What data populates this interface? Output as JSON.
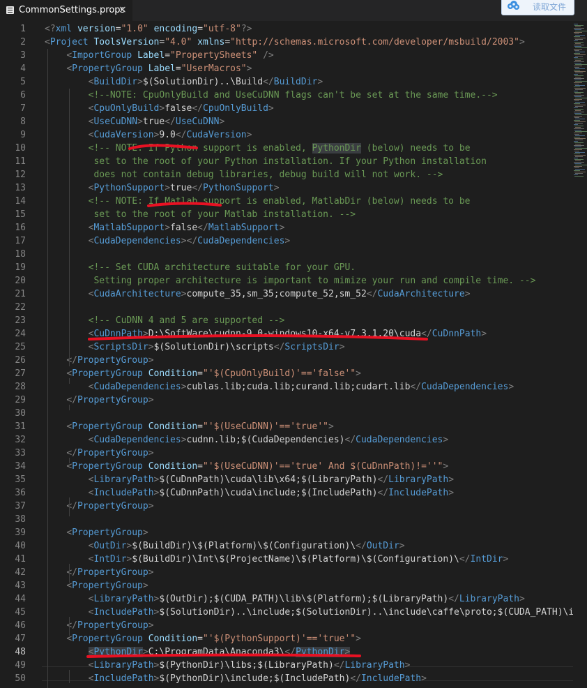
{
  "tab": {
    "title": "CommonSettings.props",
    "close": "×"
  },
  "overlay_button": {
    "label": "读取文件",
    "icon": "cloud-icon"
  },
  "colors": {
    "tag": "#569cd6",
    "bracket": "#808080",
    "attr": "#9cdcfe",
    "string": "#ce9178",
    "comment": "#6a9955",
    "text": "#d4d4d4",
    "annotation": "#e81123"
  },
  "current_line": 48,
  "lines": [
    {
      "n": "1",
      "tokens": [
        [
          "b",
          "<?"
        ],
        [
          "t",
          "xml "
        ],
        [
          "a",
          "version"
        ],
        [
          "x",
          "="
        ],
        [
          "s",
          "\"1.0\" "
        ],
        [
          "a",
          "encoding"
        ],
        [
          "x",
          "="
        ],
        [
          "s",
          "\"utf-8\""
        ],
        [
          "b",
          "?>"
        ]
      ]
    },
    {
      "n": "2",
      "tokens": [
        [
          "b",
          "<"
        ],
        [
          "t",
          "Project "
        ],
        [
          "a",
          "ToolsVersion"
        ],
        [
          "x",
          "="
        ],
        [
          "s",
          "\"4.0\" "
        ],
        [
          "a",
          "xmlns"
        ],
        [
          "x",
          "="
        ],
        [
          "s",
          "\"http://schemas.microsoft.com/developer/msbuild/2003\""
        ],
        [
          "b",
          ">"
        ]
      ]
    },
    {
      "n": "3",
      "tokens": [
        [
          "x",
          "    "
        ],
        [
          "b",
          "<"
        ],
        [
          "t",
          "ImportGroup "
        ],
        [
          "a",
          "Label"
        ],
        [
          "x",
          "="
        ],
        [
          "s",
          "\"PropertySheets\" "
        ],
        [
          "b",
          "/>"
        ]
      ]
    },
    {
      "n": "4",
      "tokens": [
        [
          "x",
          "    "
        ],
        [
          "b",
          "<"
        ],
        [
          "t",
          "PropertyGroup "
        ],
        [
          "a",
          "Label"
        ],
        [
          "x",
          "="
        ],
        [
          "s",
          "\"UserMacros\""
        ],
        [
          "b",
          ">"
        ]
      ]
    },
    {
      "n": "5",
      "tokens": [
        [
          "x",
          "        "
        ],
        [
          "b",
          "<"
        ],
        [
          "t",
          "BuildDir"
        ],
        [
          "b",
          ">"
        ],
        [
          "x",
          "$(SolutionDir)..\\Build"
        ],
        [
          "b",
          "</"
        ],
        [
          "t",
          "BuildDir"
        ],
        [
          "b",
          ">"
        ]
      ]
    },
    {
      "n": "6",
      "tokens": [
        [
          "x",
          "        "
        ],
        [
          "c",
          "<!--NOTE: CpuOnlyBuild and UseCuDNN flags can't be set at the same time.-->"
        ]
      ]
    },
    {
      "n": "7",
      "tokens": [
        [
          "x",
          "        "
        ],
        [
          "b",
          "<"
        ],
        [
          "t",
          "CpuOnlyBuild"
        ],
        [
          "b",
          ">"
        ],
        [
          "x",
          "false"
        ],
        [
          "b",
          "</"
        ],
        [
          "t",
          "CpuOnlyBuild"
        ],
        [
          "b",
          ">"
        ]
      ]
    },
    {
      "n": "8",
      "tokens": [
        [
          "x",
          "        "
        ],
        [
          "b",
          "<"
        ],
        [
          "t",
          "UseCuDNN"
        ],
        [
          "b",
          ">"
        ],
        [
          "x",
          "true"
        ],
        [
          "b",
          "</"
        ],
        [
          "t",
          "UseCuDNN"
        ],
        [
          "b",
          ">"
        ]
      ]
    },
    {
      "n": "9",
      "tokens": [
        [
          "x",
          "        "
        ],
        [
          "b",
          "<"
        ],
        [
          "t",
          "CudaVersion"
        ],
        [
          "b",
          ">"
        ],
        [
          "x",
          "9.0"
        ],
        [
          "b",
          "</"
        ],
        [
          "t",
          "CudaVersion"
        ],
        [
          "b",
          ">"
        ]
      ]
    },
    {
      "n": "10",
      "tokens": [
        [
          "x",
          "        "
        ],
        [
          "c",
          "<!-- NOTE: If Python support is enabled, "
        ],
        [
          "ch",
          "PythonDir"
        ],
        [
          "c",
          " (below) needs to be"
        ]
      ]
    },
    {
      "n": "11",
      "tokens": [
        [
          "c",
          "         set to the root of your Python installation. If your Python installation"
        ]
      ]
    },
    {
      "n": "12",
      "tokens": [
        [
          "c",
          "         does not contain debug libraries, debug build will not work. -->"
        ]
      ]
    },
    {
      "n": "13",
      "tokens": [
        [
          "x",
          "        "
        ],
        [
          "b",
          "<"
        ],
        [
          "t",
          "PythonSupport"
        ],
        [
          "b",
          ">"
        ],
        [
          "x",
          "true"
        ],
        [
          "b",
          "</"
        ],
        [
          "t",
          "PythonSupport"
        ],
        [
          "b",
          ">"
        ]
      ]
    },
    {
      "n": "14",
      "tokens": [
        [
          "x",
          "        "
        ],
        [
          "c",
          "<!-- NOTE: If Matlab support is enabled, MatlabDir (below) needs to be"
        ]
      ]
    },
    {
      "n": "15",
      "tokens": [
        [
          "c",
          "         set to the root of your Matlab installation. -->"
        ]
      ]
    },
    {
      "n": "16",
      "tokens": [
        [
          "x",
          "        "
        ],
        [
          "b",
          "<"
        ],
        [
          "t",
          "MatlabSupport"
        ],
        [
          "b",
          ">"
        ],
        [
          "x",
          "false"
        ],
        [
          "b",
          "</"
        ],
        [
          "t",
          "MatlabSupport"
        ],
        [
          "b",
          ">"
        ]
      ]
    },
    {
      "n": "17",
      "tokens": [
        [
          "x",
          "        "
        ],
        [
          "b",
          "<"
        ],
        [
          "t",
          "CudaDependencies"
        ],
        [
          "b",
          "></"
        ],
        [
          "t",
          "CudaDependencies"
        ],
        [
          "b",
          ">"
        ]
      ]
    },
    {
      "n": "18",
      "tokens": []
    },
    {
      "n": "19",
      "tokens": [
        [
          "x",
          "        "
        ],
        [
          "c",
          "<!-- Set CUDA architecture suitable for your GPU."
        ]
      ]
    },
    {
      "n": "20",
      "tokens": [
        [
          "c",
          "         Setting proper architecture is important to mimize your run and compile time. -->"
        ]
      ]
    },
    {
      "n": "21",
      "tokens": [
        [
          "x",
          "        "
        ],
        [
          "b",
          "<"
        ],
        [
          "t",
          "CudaArchitecture"
        ],
        [
          "b",
          ">"
        ],
        [
          "x",
          "compute_35,sm_35;compute_52,sm_52"
        ],
        [
          "b",
          "</"
        ],
        [
          "t",
          "CudaArchitecture"
        ],
        [
          "b",
          ">"
        ]
      ]
    },
    {
      "n": "22",
      "tokens": []
    },
    {
      "n": "23",
      "tokens": [
        [
          "x",
          "        "
        ],
        [
          "c",
          "<!-- CuDNN 4 and 5 are supported -->"
        ]
      ]
    },
    {
      "n": "24",
      "tokens": [
        [
          "x",
          "        "
        ],
        [
          "b",
          "<"
        ],
        [
          "t",
          "CuDnnPath"
        ],
        [
          "b",
          ">"
        ],
        [
          "x",
          "D:\\SoftWare\\cudnn-9.0-windows10-x64-v7.3.1.20\\cuda"
        ],
        [
          "b",
          "</"
        ],
        [
          "t",
          "CuDnnPath"
        ],
        [
          "b",
          ">"
        ]
      ]
    },
    {
      "n": "25",
      "tokens": [
        [
          "x",
          "        "
        ],
        [
          "b",
          "<"
        ],
        [
          "t",
          "ScriptsDir"
        ],
        [
          "b",
          ">"
        ],
        [
          "x",
          "$(SolutionDir)\\scripts"
        ],
        [
          "b",
          "</"
        ],
        [
          "t",
          "ScriptsDir"
        ],
        [
          "b",
          ">"
        ]
      ]
    },
    {
      "n": "26",
      "tokens": [
        [
          "x",
          "    "
        ],
        [
          "b",
          "</"
        ],
        [
          "t",
          "PropertyGroup"
        ],
        [
          "b",
          ">"
        ]
      ]
    },
    {
      "n": "27",
      "tokens": [
        [
          "x",
          "    "
        ],
        [
          "b",
          "<"
        ],
        [
          "t",
          "PropertyGroup "
        ],
        [
          "a",
          "Condition"
        ],
        [
          "x",
          "="
        ],
        [
          "s",
          "\"'$(CpuOnlyBuild)'=='false'\""
        ],
        [
          "b",
          ">"
        ]
      ]
    },
    {
      "n": "28",
      "tokens": [
        [
          "x",
          "        "
        ],
        [
          "b",
          "<"
        ],
        [
          "t",
          "CudaDependencies"
        ],
        [
          "b",
          ">"
        ],
        [
          "x",
          "cublas.lib;cuda.lib;curand.lib;cudart.lib"
        ],
        [
          "b",
          "</"
        ],
        [
          "t",
          "CudaDependencies"
        ],
        [
          "b",
          ">"
        ]
      ]
    },
    {
      "n": "29",
      "tokens": [
        [
          "x",
          "    "
        ],
        [
          "b",
          "</"
        ],
        [
          "t",
          "PropertyGroup"
        ],
        [
          "b",
          ">"
        ]
      ]
    },
    {
      "n": "30",
      "tokens": []
    },
    {
      "n": "31",
      "tokens": [
        [
          "x",
          "    "
        ],
        [
          "b",
          "<"
        ],
        [
          "t",
          "PropertyGroup "
        ],
        [
          "a",
          "Condition"
        ],
        [
          "x",
          "="
        ],
        [
          "s",
          "\"'$(UseCuDNN)'=='true'\""
        ],
        [
          "b",
          ">"
        ]
      ]
    },
    {
      "n": "32",
      "tokens": [
        [
          "x",
          "        "
        ],
        [
          "b",
          "<"
        ],
        [
          "t",
          "CudaDependencies"
        ],
        [
          "b",
          ">"
        ],
        [
          "x",
          "cudnn.lib;$(CudaDependencies)"
        ],
        [
          "b",
          "</"
        ],
        [
          "t",
          "CudaDependencies"
        ],
        [
          "b",
          ">"
        ]
      ]
    },
    {
      "n": "33",
      "tokens": [
        [
          "x",
          "    "
        ],
        [
          "b",
          "</"
        ],
        [
          "t",
          "PropertyGroup"
        ],
        [
          "b",
          ">"
        ]
      ]
    },
    {
      "n": "34",
      "tokens": [
        [
          "x",
          "    "
        ],
        [
          "b",
          "<"
        ],
        [
          "t",
          "PropertyGroup "
        ],
        [
          "a",
          "Condition"
        ],
        [
          "x",
          "="
        ],
        [
          "s",
          "\"'$(UseCuDNN)'=='true' And $(CuDnnPath)!=''\""
        ],
        [
          "b",
          ">"
        ]
      ]
    },
    {
      "n": "35",
      "tokens": [
        [
          "x",
          "        "
        ],
        [
          "b",
          "<"
        ],
        [
          "t",
          "LibraryPath"
        ],
        [
          "b",
          ">"
        ],
        [
          "x",
          "$(CuDnnPath)\\cuda\\lib\\x64;$(LibraryPath)"
        ],
        [
          "b",
          "</"
        ],
        [
          "t",
          "LibraryPath"
        ],
        [
          "b",
          ">"
        ]
      ]
    },
    {
      "n": "36",
      "tokens": [
        [
          "x",
          "        "
        ],
        [
          "b",
          "<"
        ],
        [
          "t",
          "IncludePath"
        ],
        [
          "b",
          ">"
        ],
        [
          "x",
          "$(CuDnnPath)\\cuda\\include;$(IncludePath)"
        ],
        [
          "b",
          "</"
        ],
        [
          "t",
          "IncludePath"
        ],
        [
          "b",
          ">"
        ]
      ]
    },
    {
      "n": "37",
      "tokens": [
        [
          "x",
          "    "
        ],
        [
          "b",
          "</"
        ],
        [
          "t",
          "PropertyGroup"
        ],
        [
          "b",
          ">"
        ]
      ]
    },
    {
      "n": "38",
      "tokens": []
    },
    {
      "n": "39",
      "tokens": [
        [
          "x",
          "    "
        ],
        [
          "b",
          "<"
        ],
        [
          "t",
          "PropertyGroup"
        ],
        [
          "b",
          ">"
        ]
      ]
    },
    {
      "n": "40",
      "tokens": [
        [
          "x",
          "        "
        ],
        [
          "b",
          "<"
        ],
        [
          "t",
          "OutDir"
        ],
        [
          "b",
          ">"
        ],
        [
          "x",
          "$(BuildDir)\\$(Platform)\\$(Configuration)\\"
        ],
        [
          "b",
          "</"
        ],
        [
          "t",
          "OutDir"
        ],
        [
          "b",
          ">"
        ]
      ]
    },
    {
      "n": "41",
      "tokens": [
        [
          "x",
          "        "
        ],
        [
          "b",
          "<"
        ],
        [
          "t",
          "IntDir"
        ],
        [
          "b",
          ">"
        ],
        [
          "x",
          "$(BuildDir)\\Int\\$(ProjectName)\\$(Platform)\\$(Configuration)\\"
        ],
        [
          "b",
          "</"
        ],
        [
          "t",
          "IntDir"
        ],
        [
          "b",
          ">"
        ]
      ]
    },
    {
      "n": "42",
      "tokens": [
        [
          "x",
          "    "
        ],
        [
          "b",
          "</"
        ],
        [
          "t",
          "PropertyGroup"
        ],
        [
          "b",
          ">"
        ]
      ]
    },
    {
      "n": "43",
      "tokens": [
        [
          "x",
          "    "
        ],
        [
          "b",
          "<"
        ],
        [
          "t",
          "PropertyGroup"
        ],
        [
          "b",
          ">"
        ]
      ]
    },
    {
      "n": "44",
      "tokens": [
        [
          "x",
          "        "
        ],
        [
          "b",
          "<"
        ],
        [
          "t",
          "LibraryPath"
        ],
        [
          "b",
          ">"
        ],
        [
          "x",
          "$(OutDir);$(CUDA_PATH)\\lib\\$(Platform);$(LibraryPath)"
        ],
        [
          "b",
          "</"
        ],
        [
          "t",
          "LibraryPath"
        ],
        [
          "b",
          ">"
        ]
      ]
    },
    {
      "n": "45",
      "tokens": [
        [
          "x",
          "        "
        ],
        [
          "b",
          "<"
        ],
        [
          "t",
          "IncludePath"
        ],
        [
          "b",
          ">"
        ],
        [
          "x",
          "$(SolutionDir)..\\include;$(SolutionDir)..\\include\\caffe\\proto;$(CUDA_PATH)\\inc"
        ]
      ]
    },
    {
      "n": "46",
      "tokens": [
        [
          "x",
          "    "
        ],
        [
          "b",
          "</"
        ],
        [
          "t",
          "PropertyGroup"
        ],
        [
          "b",
          ">"
        ]
      ]
    },
    {
      "n": "47",
      "tokens": [
        [
          "x",
          "    "
        ],
        [
          "b",
          "<"
        ],
        [
          "t",
          "PropertyGroup "
        ],
        [
          "a",
          "Condition"
        ],
        [
          "x",
          "="
        ],
        [
          "s",
          "\"'$(PythonSupport)'=='true'\""
        ],
        [
          "b",
          ">"
        ]
      ]
    },
    {
      "n": "48",
      "tokens": [
        [
          "x",
          "        "
        ],
        [
          "bh",
          "<"
        ],
        [
          "th",
          "PythonDir"
        ],
        [
          "b",
          ">"
        ],
        [
          "x",
          "C:\\ProgramData\\Anaconda3\\"
        ],
        [
          "b",
          "</"
        ],
        [
          "th",
          "PythonDir"
        ],
        [
          "bh",
          ">"
        ]
      ]
    },
    {
      "n": "49",
      "tokens": [
        [
          "x",
          "        "
        ],
        [
          "b",
          "<"
        ],
        [
          "t",
          "LibraryPath"
        ],
        [
          "b",
          ">"
        ],
        [
          "x",
          "$(PythonDir)\\libs;$(LibraryPath)"
        ],
        [
          "b",
          "</"
        ],
        [
          "t",
          "LibraryPath"
        ],
        [
          "b",
          ">"
        ]
      ]
    },
    {
      "n": "50",
      "tokens": [
        [
          "x",
          "        "
        ],
        [
          "b",
          "<"
        ],
        [
          "t",
          "IncludePath"
        ],
        [
          "b",
          ">"
        ],
        [
          "x",
          "$(PythonDir)\\include;$(IncludePath)"
        ],
        [
          "b",
          "</"
        ],
        [
          "t",
          "IncludePath"
        ],
        [
          "b",
          ">"
        ]
      ]
    }
  ]
}
